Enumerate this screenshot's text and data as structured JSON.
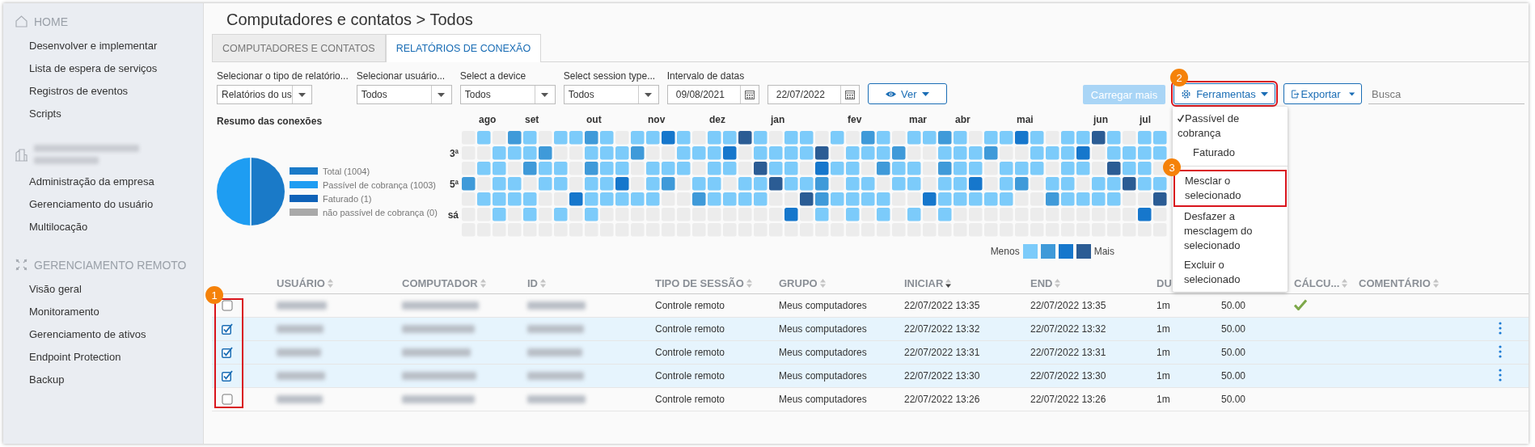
{
  "sidebar": {
    "sections": [
      {
        "kind": "home",
        "title": "HOME",
        "items": [
          {
            "label": "Desenvolver e implementar",
            "selected": false
          },
          {
            "label": "Lista de espera de serviços",
            "selected": false
          },
          {
            "label": "Registros de eventos",
            "selected": false
          },
          {
            "label": "Scripts",
            "selected": false
          }
        ]
      },
      {
        "kind": "company",
        "items": [
          {
            "label": "Administração da empresa",
            "selected": false
          },
          {
            "label": "Gerenciamento do usuário",
            "selected": false
          },
          {
            "label": "Multilocação",
            "selected": false
          }
        ]
      },
      {
        "kind": "remote",
        "title": "GERENCIAMENTO REMOTO",
        "items": [
          {
            "label": "Visão geral",
            "selected": false
          },
          {
            "label": "Monitoramento",
            "selected": false
          },
          {
            "label": "Gerenciamento de ativos",
            "selected": false
          },
          {
            "label": "Endpoint Protection",
            "selected": false
          },
          {
            "label": "Backup",
            "selected": false
          }
        ]
      }
    ]
  },
  "page_title": "Computadores e contatos > Todos",
  "tabs": [
    {
      "label": "COMPUTADORES E CONTATOS",
      "selected": false
    },
    {
      "label": "RELATÓRIOS DE CONEXÃO",
      "selected": true
    }
  ],
  "filters": [
    {
      "kind": "select",
      "label": "Selecionar o tipo de relatório...",
      "value": "Relatórios do us"
    },
    {
      "kind": "select",
      "label": "Selecionar usuário...",
      "value": "Todos"
    },
    {
      "kind": "select",
      "label": "Select a device",
      "value": "Todos"
    },
    {
      "kind": "select",
      "label": "Select session type...",
      "value": "Todos"
    },
    {
      "kind": "daterange",
      "label": "Intervalo de datas",
      "values": [
        "09/08/2021",
        "22/07/2022"
      ]
    }
  ],
  "view_button": {
    "label": "Ver"
  },
  "toolbar": {
    "load_more": {
      "label": "Carregar mais",
      "disabled": true
    },
    "tools": {
      "label": "Ferramentas",
      "expanded": true,
      "annotation": "2"
    },
    "export": {
      "label": "Exportar"
    },
    "search": {
      "placeholder": "Busca"
    }
  },
  "tools_menu": [
    {
      "kind": "check",
      "label": "Passível de cobrança",
      "checked": true
    },
    {
      "kind": "check",
      "label": "Faturado",
      "checked": false
    },
    {
      "kind": "separator"
    },
    {
      "kind": "action",
      "label": "Mesclar o selecionado",
      "annotation": "3"
    },
    {
      "kind": "action",
      "label": "Desfazer a mesclagem do selecionado"
    },
    {
      "kind": "action",
      "label": "Excluir o selecionado"
    }
  ],
  "summary": {
    "title": "Resumo das conexões",
    "legend": [
      {
        "label": "Total (1004)",
        "color": "#1a7ac8"
      },
      {
        "label": "Passível de cobrança (1003)",
        "color": "#1e9df2"
      },
      {
        "label": "Faturado (1)",
        "color": "#0f62b8"
      },
      {
        "label": "não passível de cobrança (0)",
        "color": "#a9a9a9"
      }
    ]
  },
  "heatmap": {
    "months": [
      "ago",
      "set",
      "out",
      "nov",
      "dez",
      "jan",
      "fev",
      "mar",
      "abr",
      "mai",
      "jun",
      "jul"
    ],
    "days": [
      "3ª",
      "5ª",
      "sá"
    ],
    "legend": {
      "less": "Menos",
      "more": "Mais"
    }
  },
  "table": {
    "annotation": "1",
    "columns": [
      {
        "kind": "checkbox"
      },
      {
        "kind": "text",
        "label": "USUÁRIO",
        "sorted": false
      },
      {
        "kind": "text",
        "label": "COMPUTADOR",
        "sorted": false
      },
      {
        "kind": "text",
        "label": "ID",
        "sorted": false
      },
      {
        "kind": "text",
        "label": "TIPO DE SESSÃO",
        "sorted": false
      },
      {
        "kind": "text",
        "label": "GRUPO",
        "sorted": false
      },
      {
        "kind": "text",
        "label": "INICIAR",
        "sorted": true
      },
      {
        "kind": "text",
        "label": "END",
        "sorted": false
      },
      {
        "kind": "text",
        "label": "DU"
      },
      {
        "kind": "covered"
      },
      {
        "kind": "text",
        "label": "CÁLCU...",
        "sorted": false
      },
      {
        "kind": "text",
        "label": "COMENTÁRIO",
        "sorted": false
      },
      {
        "kind": "actions"
      }
    ],
    "rows": [
      {
        "selected": false,
        "session_type": "Controle remoto",
        "group": "Meus computadores",
        "start": "22/07/2022 13:35",
        "end": "22/07/2022 13:35",
        "duration": "1m",
        "column_10": "50.00",
        "calculated": true
      },
      {
        "selected": true,
        "session_type": "Controle remoto",
        "group": "Meus computadores",
        "start": "22/07/2022 13:32",
        "end": "22/07/2022 13:32",
        "duration": "1m",
        "column_10": "50.00",
        "calculated": false
      },
      {
        "selected": true,
        "session_type": "Controle remoto",
        "group": "Meus computadores",
        "start": "22/07/2022 13:31",
        "end": "22/07/2022 13:31",
        "duration": "1m",
        "column_10": "50.00",
        "calculated": false
      },
      {
        "selected": true,
        "session_type": "Controle remoto",
        "group": "Meus computadores",
        "start": "22/07/2022 13:30",
        "end": "22/07/2022 13:30",
        "duration": "1m",
        "column_10": "50.00",
        "calculated": false
      },
      {
        "selected": false,
        "session_type": "Controle remoto",
        "group": "Meus computadores",
        "start": "22/07/2022 13:26",
        "end": "22/07/2022 13:26",
        "duration": "1m",
        "column_10": "50.00",
        "calculated": false
      }
    ]
  }
}
